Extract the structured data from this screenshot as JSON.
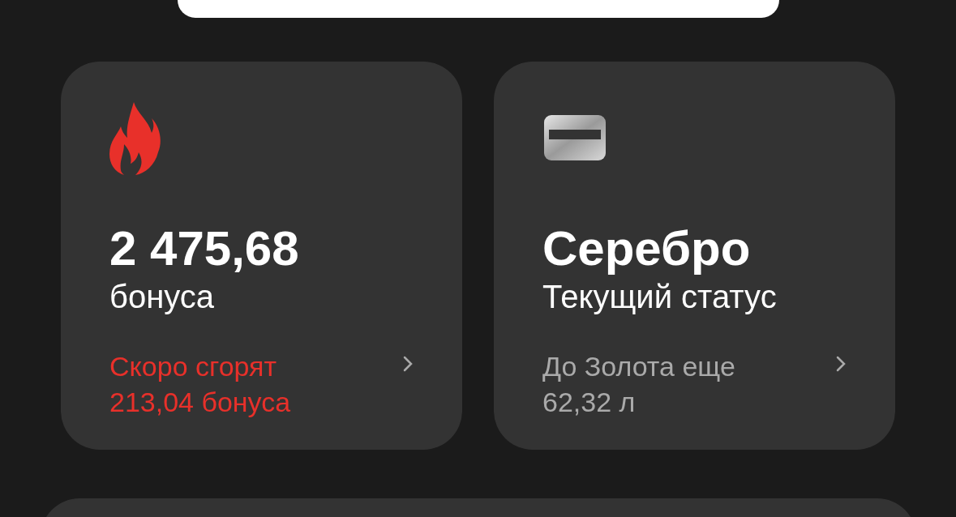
{
  "cards": [
    {
      "kind": "bonus",
      "value": "2 475,68",
      "label": "бонуса",
      "note": "Скоро сгорят\n213,04 бонуса"
    },
    {
      "kind": "status",
      "value": "Серебро",
      "label": "Текущий статус",
      "note": "До Золота еще\n62,32 л"
    }
  ]
}
